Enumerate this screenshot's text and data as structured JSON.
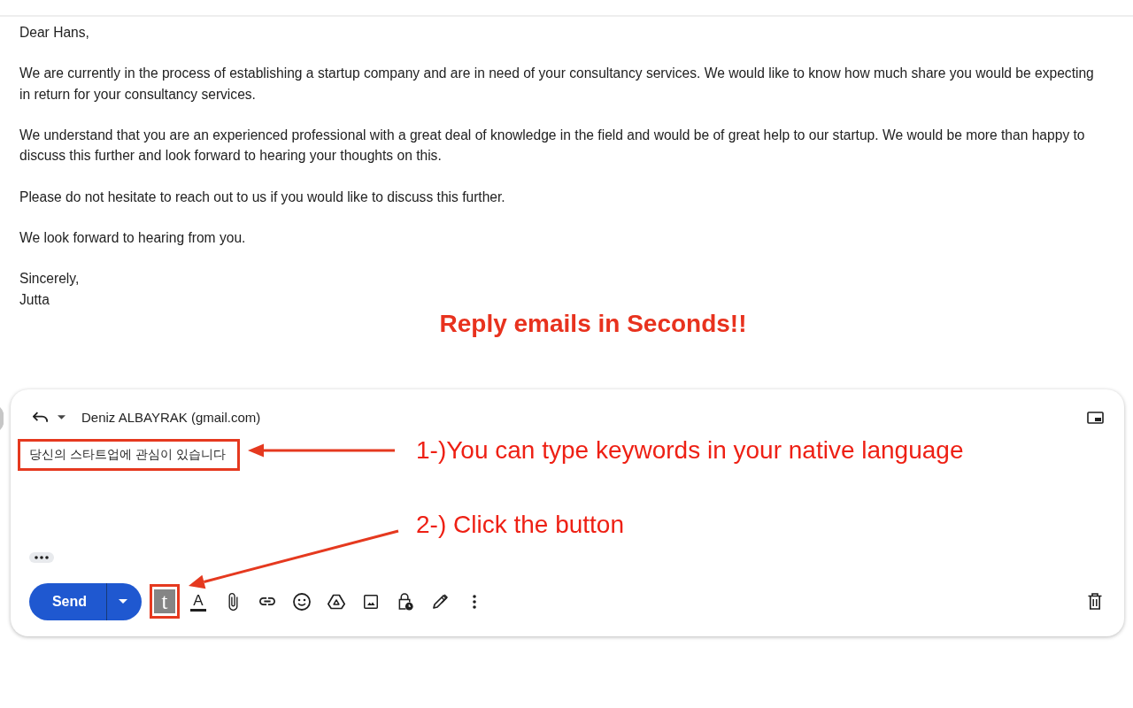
{
  "email": {
    "greeting": "Dear Hans,",
    "paragraphs": [
      "We are currently in the process of establishing a startup company and are in need of your consultancy services. We would like to know how much share you would be expecting in return for your consultancy services.",
      "We understand that you are an experienced professional with a great deal of knowledge in the field and would be of great help to our startup. We would be more than happy to discuss this further and look forward to hearing your thoughts on this.",
      "Please do not hesitate to reach out to us if you would like to discuss this further.",
      "We look forward to hearing from you."
    ],
    "valediction": "Sincerely,",
    "signature": "Jutta"
  },
  "headline": "Reply emails in Seconds!!",
  "reply": {
    "recipient": "Deniz ALBAYRAK (gmail.com)",
    "body": "당신의 스타트업에 관심이 있습니다",
    "send_label": "Send",
    "extension_label": "t",
    "format_label": "A"
  },
  "annotations": [
    {
      "text": "1-)You can type keywords in your native language"
    },
    {
      "text": "2-) Click the button"
    }
  ]
}
